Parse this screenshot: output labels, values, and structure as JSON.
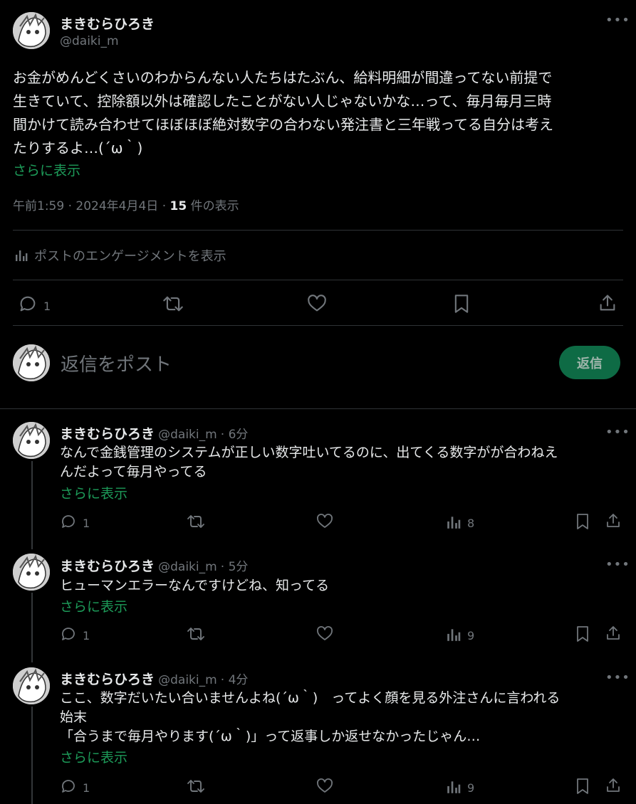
{
  "main_post": {
    "author_name": "まきむらひろき",
    "handle": "@daiki_m",
    "lines": [
      "お金がめんどくさいのわからんない人たちはたぶん、給料明細が間違ってない前提で",
      "生きていて、控除額以外は確認したことがない人じゃないかな…って、毎月毎月三時",
      "間かけて読み合わせてほぼほぼ絶対数字の合わない発注書と三年戦ってる自分は考え",
      "たりするよ…(´ω｀)"
    ],
    "show_more": "さらに表示",
    "time": "午前1:59",
    "date": "2024年4月4日",
    "views_count": "15",
    "views_label": "件の表示",
    "engagement_label": "ポストのエンゲージメントを表示",
    "reply_count": "1"
  },
  "composer": {
    "placeholder": "返信をポスト",
    "button_label": "返信"
  },
  "replies": [
    {
      "name": "まきむらひろき",
      "handle": "@daiki_m",
      "time": "6分",
      "text": "なんで金銭管理のシステムが正しい数字吐いてるのに、出てくる数字がが合わねえ\nんだよって毎月やってる",
      "show_more": "さらに表示",
      "reply_count": "1",
      "views": "8"
    },
    {
      "name": "まきむらひろき",
      "handle": "@daiki_m",
      "time": "5分",
      "text": "ヒューマンエラーなんですけどね、知ってる",
      "show_more": "さらに表示",
      "reply_count": "1",
      "views": "9"
    },
    {
      "name": "まきむらひろき",
      "handle": "@daiki_m",
      "time": "4分",
      "text": "ここ、数字だいたい合いませんよね(´ω｀)　ってよく顔を見る外注さんに言われる\n始末\n「合うまで毎月やります(´ω｀)」って返事しか返せなかったじゃん…",
      "show_more": "さらに表示",
      "reply_count": "1",
      "views": "9"
    }
  ],
  "colors": {
    "background": "#000000",
    "text": "#e7e9ea",
    "muted": "#71767b",
    "link_green": "#1d9b59",
    "button_bg": "#0e6b45",
    "divider": "#2f3336"
  }
}
